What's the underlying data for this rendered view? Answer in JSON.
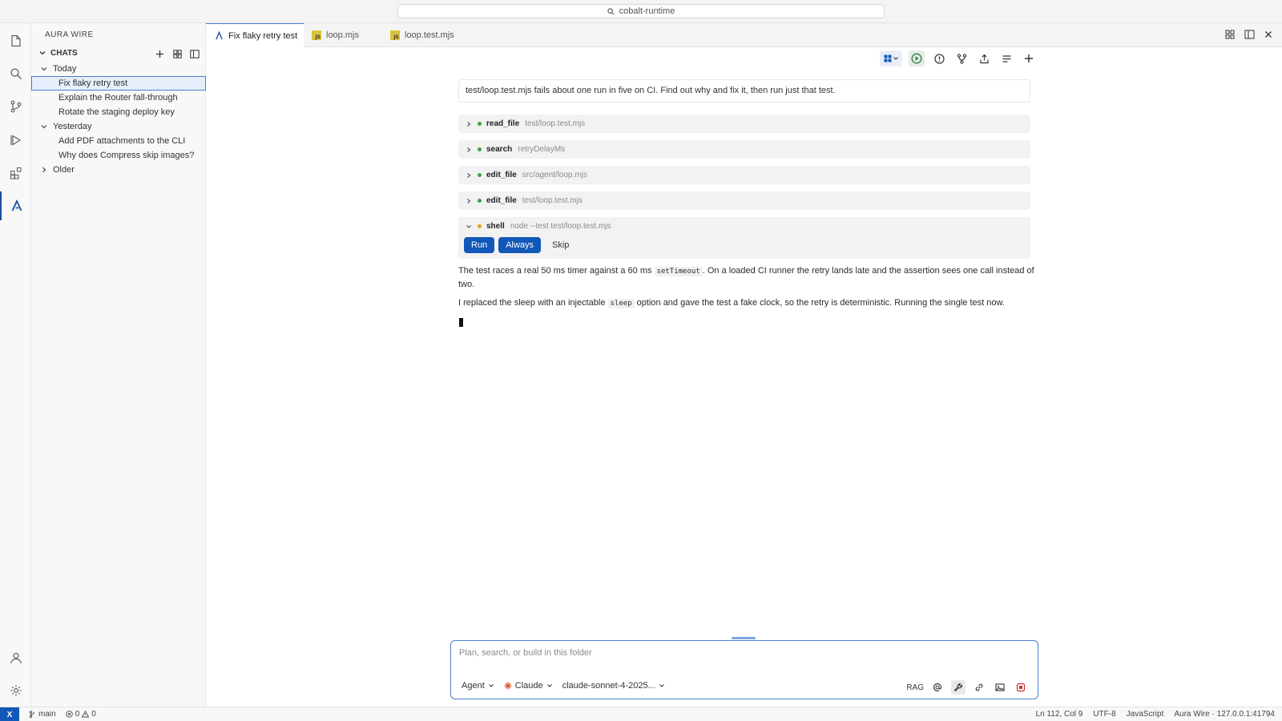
{
  "titlebar": {
    "search_text": "cobalt-runtime"
  },
  "sidebar": {
    "title": "AURA WIRE",
    "section": "CHATS",
    "groups": [
      {
        "label": "Today",
        "items": [
          "Fix flaky retry test",
          "Explain the Router fall-through",
          "Rotate the staging deploy key"
        ]
      },
      {
        "label": "Yesterday",
        "items": [
          "Add PDF attachments to the CLI",
          "Why does Compress skip images?"
        ]
      },
      {
        "label": "Older",
        "items": []
      }
    ]
  },
  "tabs": [
    {
      "label": "Fix flaky retry test",
      "icon": "aura-wire-icon",
      "active": true
    },
    {
      "label": "loop.mjs",
      "icon": "js-file-icon",
      "active": false
    },
    {
      "label": "loop.test.mjs",
      "icon": "js-file-icon",
      "active": false
    }
  ],
  "js_badge": "JS",
  "chat": {
    "user_prompt": "test/loop.test.mjs fails about one run in five on CI. Find out why and fix it, then run just that test.",
    "tool_calls": [
      {
        "name": "read_file",
        "arg": "test/loop.test.mjs",
        "status": "done"
      },
      {
        "name": "search",
        "arg": "retryDelayMs",
        "status": "done"
      },
      {
        "name": "edit_file",
        "arg": "src/agent/loop.mjs",
        "status": "done"
      },
      {
        "name": "edit_file",
        "arg": "test/loop.test.mjs",
        "status": "done"
      }
    ],
    "pending_tool": {
      "name": "shell",
      "arg": "node --test test/loop.test.mjs",
      "status": "pending",
      "actions": {
        "run": "Run",
        "always": "Always",
        "skip": "Skip"
      }
    },
    "reply": {
      "p1_a": "The test races a real 50 ms timer against a 60 ms ",
      "p1_code": "setTimeout",
      "p1_b": ". On a loaded CI runner the retry lands late and the assertion sees one call instead of two.",
      "p2_a": "I replaced the sleep with an injectable ",
      "p2_code": "sleep",
      "p2_b": " option and gave the test a fake clock, so the retry is deterministic. Running the single test now."
    }
  },
  "composer": {
    "placeholder": "Plan, search, or build in this folder",
    "mode": "Agent",
    "provider": "Claude",
    "model": "claude-sonnet-4-2025...",
    "rag_label": "RAG"
  },
  "statusbar": {
    "remote": "X",
    "branch": "main",
    "errors": "0",
    "warnings": "0",
    "position": "Ln 112, Col 9",
    "encoding": "UTF-8",
    "language": "JavaScript",
    "server": "Aura Wire · 127.0.0.1:41794"
  },
  "colors": {
    "accent": "#1158b8",
    "done_dot": "#43a047",
    "pending_dot": "#e0a21c",
    "provider": "#d9542b"
  }
}
